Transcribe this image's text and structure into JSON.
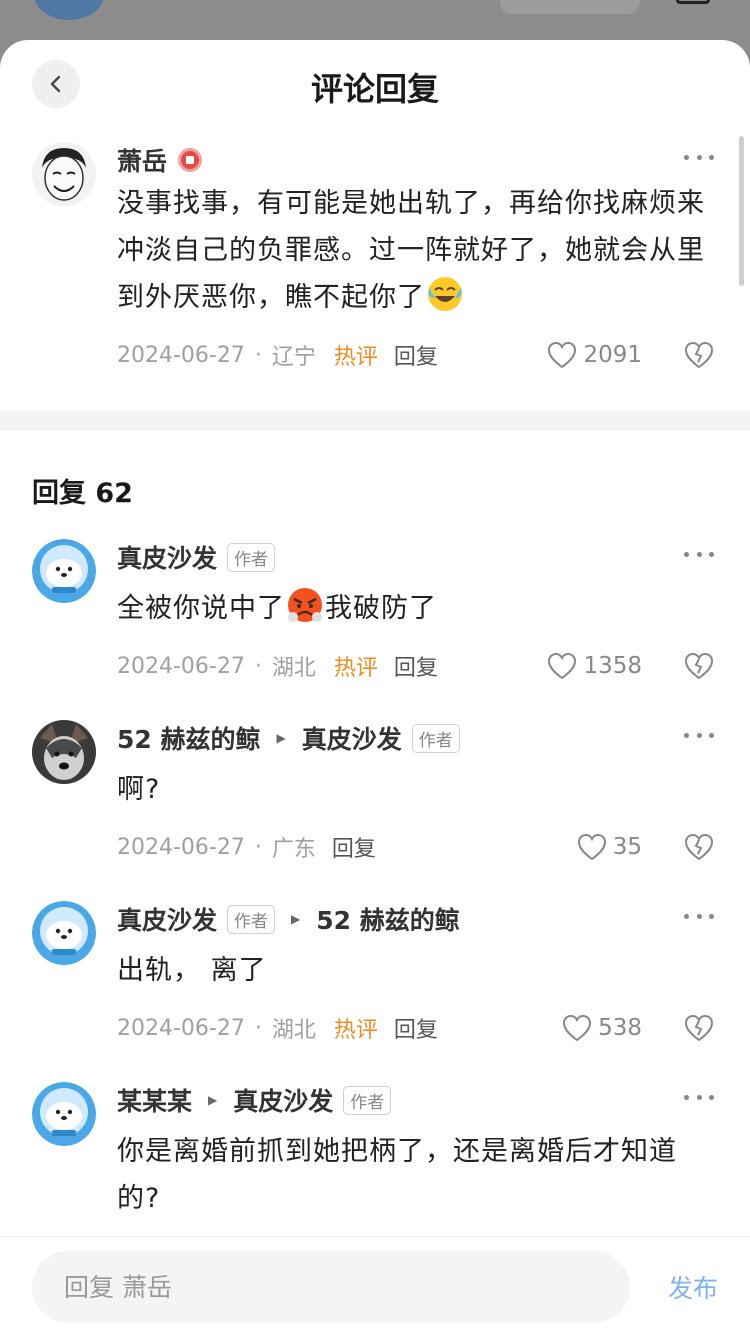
{
  "header": {
    "title": "评论回复"
  },
  "main_comment": {
    "author": "萧岳",
    "text": "没事找事，有可能是她出轨了，再给你找麻烦来冲淡自己的负罪感。过一阵就好了，她就会从里到外厌恶你，瞧不起你了",
    "date": "2024-06-27",
    "location": "辽宁",
    "hot_label": "热评",
    "reply_label": "回复",
    "likes": "2091"
  },
  "replies_header": "回复 62",
  "replies": [
    {
      "author": "真皮沙发",
      "author_tag": "作者",
      "text_before": "全被你说中了",
      "text_after": "我破防了",
      "date": "2024-06-27",
      "location": "湖北",
      "hot_label": "热评",
      "reply_label": "回复",
      "likes": "1358"
    },
    {
      "author": "52 赫兹的鲸",
      "reply_to": "真皮沙发",
      "reply_to_tag": "作者",
      "text": "啊?",
      "date": "2024-06-27",
      "location": "广东",
      "reply_label": "回复",
      "likes": "35"
    },
    {
      "author": "真皮沙发",
      "author_tag": "作者",
      "reply_to": "52 赫兹的鲸",
      "text": "出轨， 离了",
      "date": "2024-06-27",
      "location": "湖北",
      "hot_label": "热评",
      "reply_label": "回复",
      "likes": "538"
    },
    {
      "author": "某某某",
      "reply_to": "真皮沙发",
      "reply_to_tag": "作者",
      "text": "你是离婚前抓到她把柄了，还是离婚后才知道的?"
    }
  ],
  "bottom": {
    "input_placeholder": "回复 萧岳",
    "publish_label": "发布"
  },
  "colors": {
    "hot": "#f58a1f",
    "publish": "#7fb2ef"
  }
}
